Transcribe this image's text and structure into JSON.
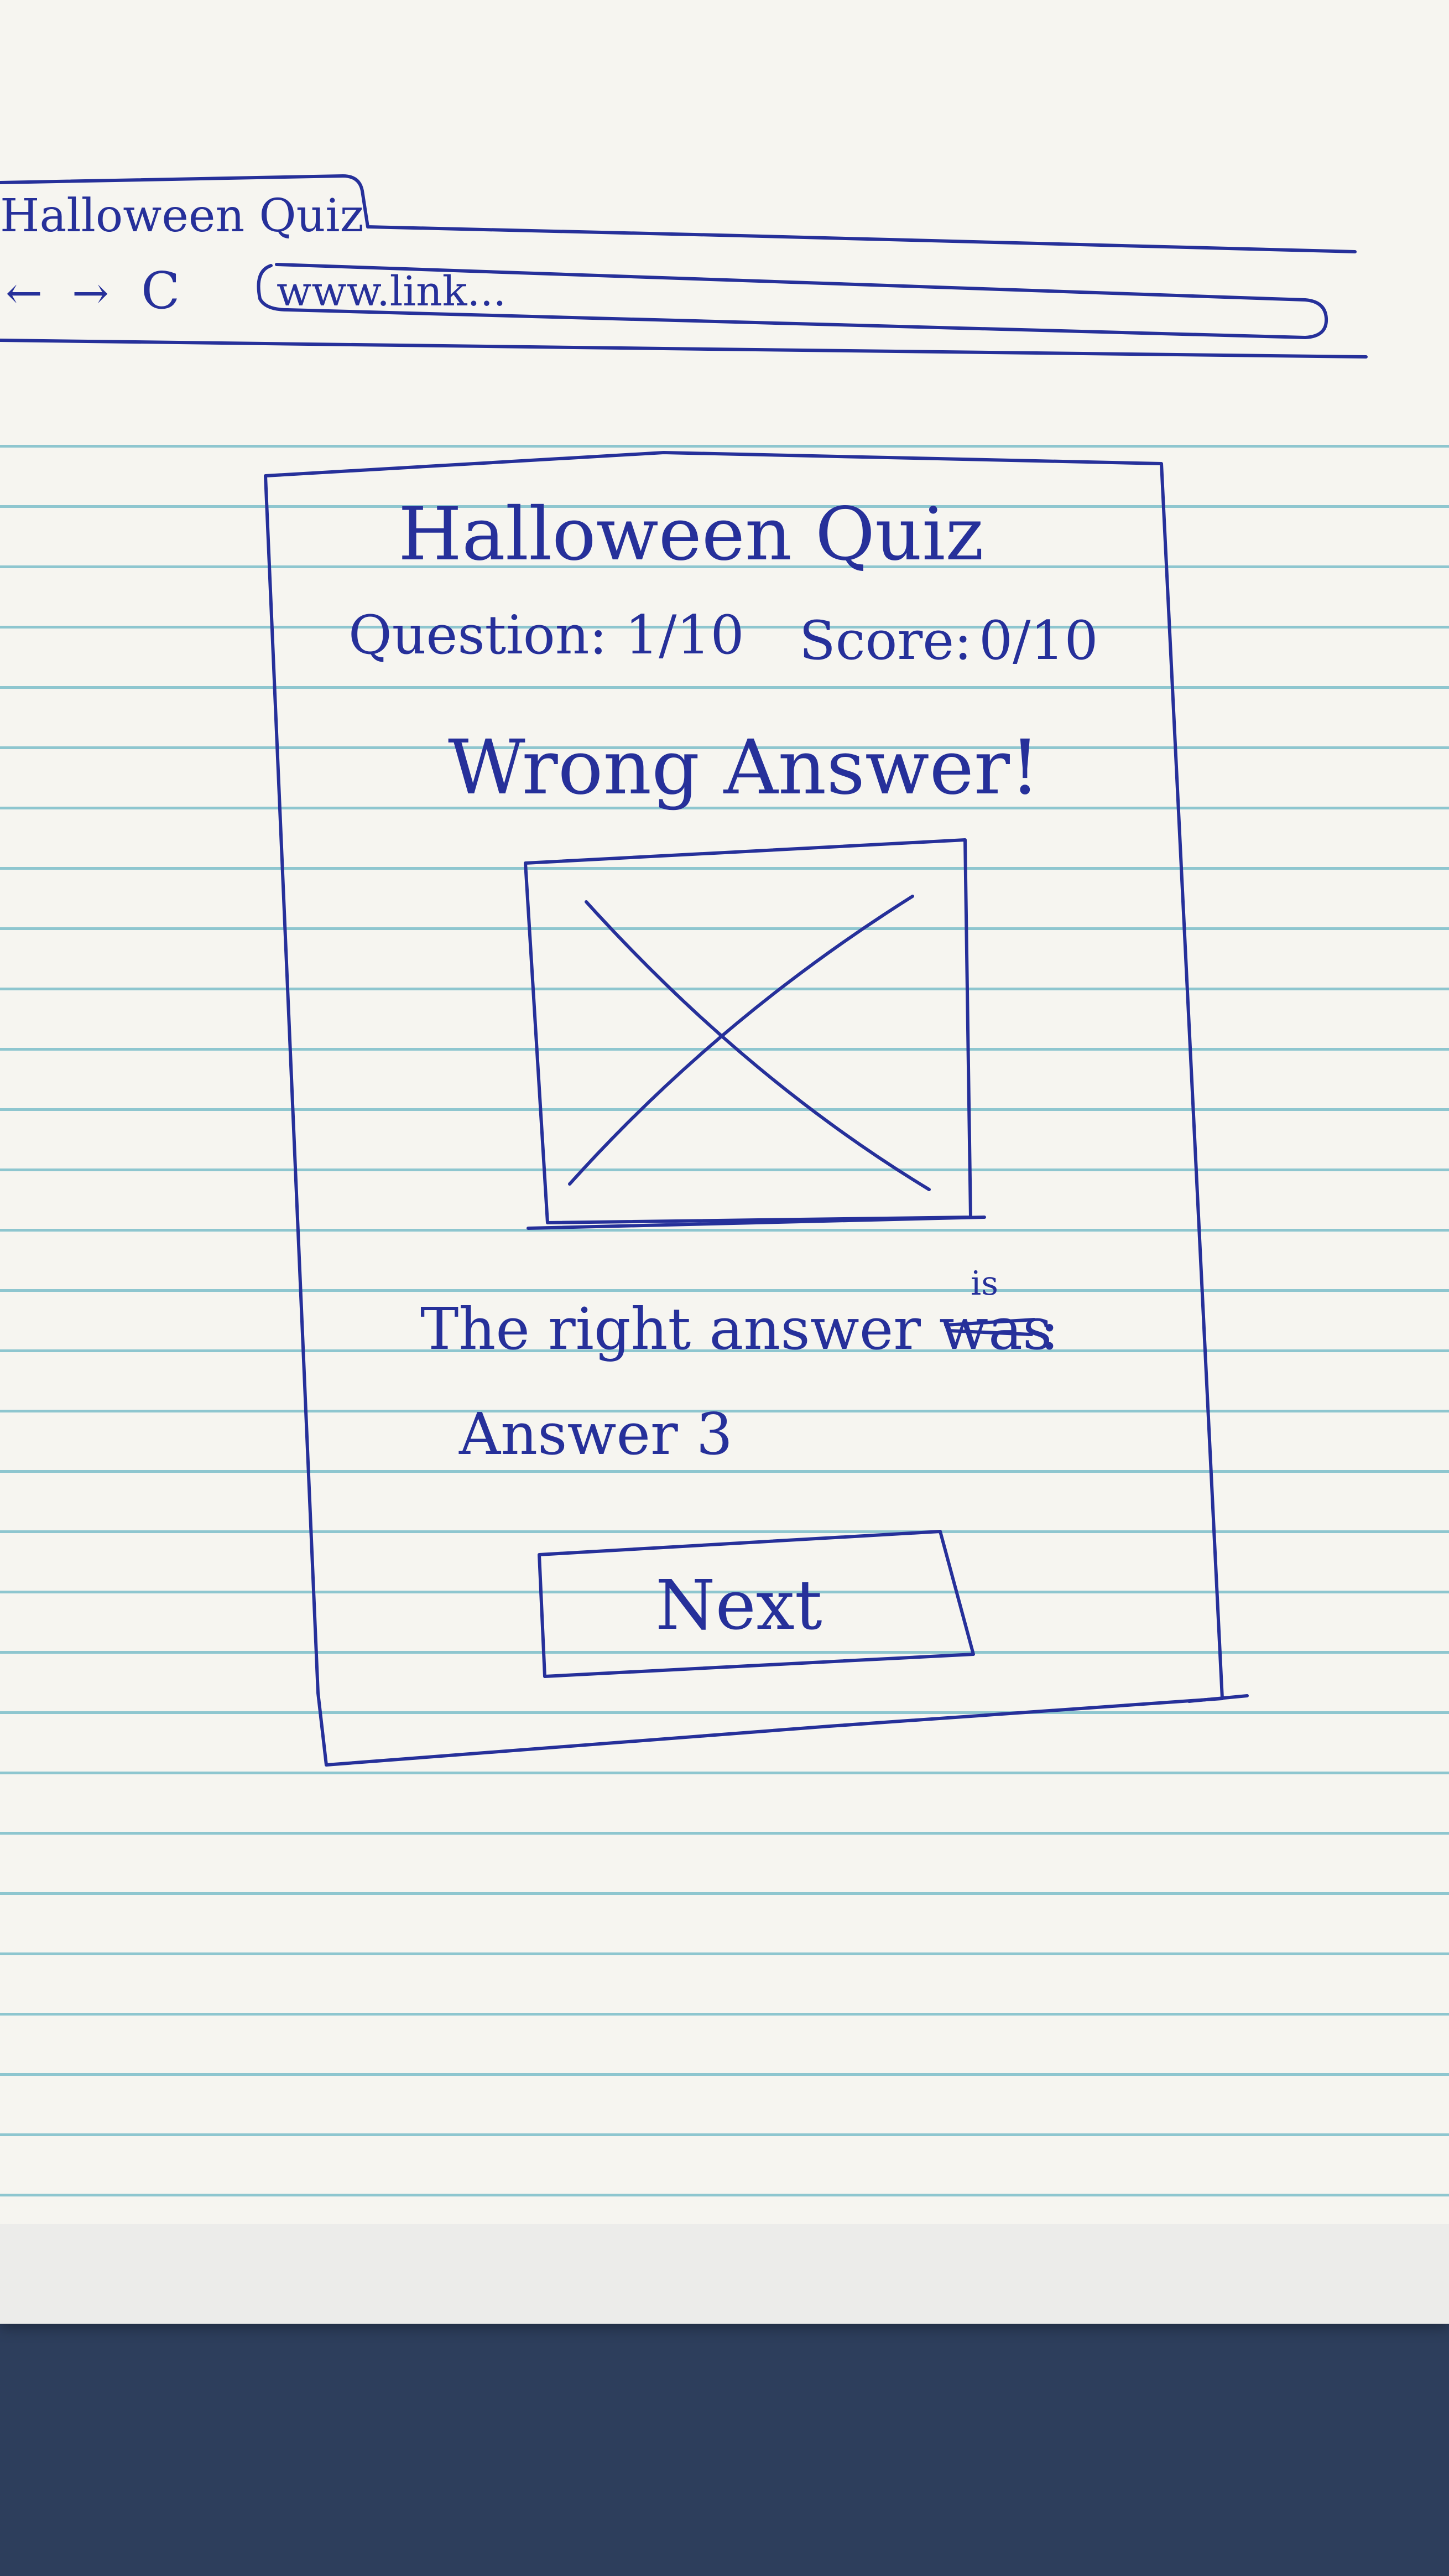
{
  "browser": {
    "tab_title": "Halloween Quiz",
    "back_symbol": "←",
    "forward_symbol": "→",
    "refresh_symbol": "C",
    "url": "www.link..."
  },
  "quiz": {
    "title": "Halloween Quiz",
    "question_label": "Question:",
    "question_value": "1/10",
    "score_label": "Score:",
    "score_value": "0/10",
    "feedback": "Wrong Answer!",
    "answer_intro": "The right answer was",
    "answer_intro_insert": "is",
    "answer_intro_colon": ":",
    "answer": "Answer 3",
    "next_label": "Next"
  },
  "colors": {
    "ink": "#26309a",
    "paper": "#f6f5f0",
    "ruled_line": "#8ec6cf"
  },
  "icons": {
    "image": "image-placeholder-icon",
    "back": "arrow-left-icon",
    "forward": "arrow-right-icon",
    "refresh": "refresh-icon"
  }
}
